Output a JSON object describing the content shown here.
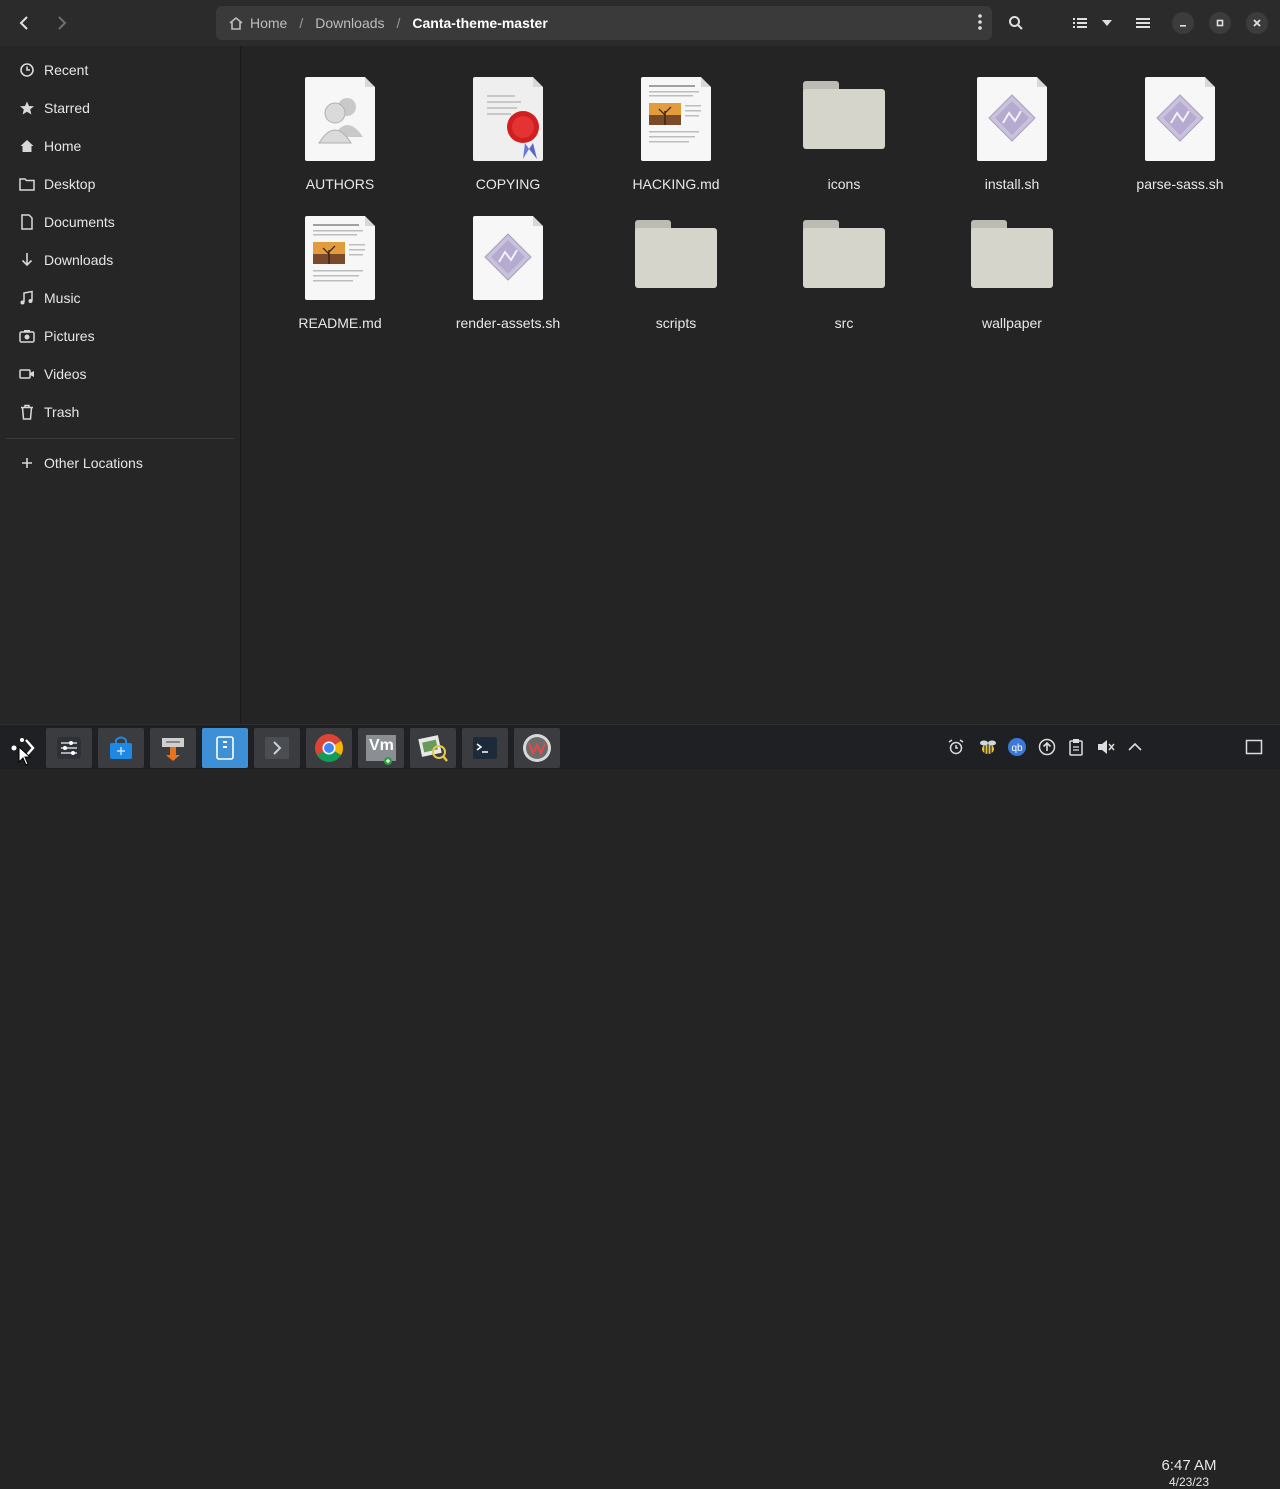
{
  "window": {
    "breadcrumb": [
      {
        "label": "Home",
        "icon": "home-icon"
      },
      {
        "label": "Downloads"
      },
      {
        "label": "Canta-theme-master"
      }
    ],
    "separator": "/"
  },
  "sidebar": {
    "items": [
      {
        "label": "Recent",
        "icon": "clock-icon"
      },
      {
        "label": "Starred",
        "icon": "star-icon"
      },
      {
        "label": "Home",
        "icon": "home-icon"
      },
      {
        "label": "Desktop",
        "icon": "folder-icon"
      },
      {
        "label": "Documents",
        "icon": "document-icon"
      },
      {
        "label": "Downloads",
        "icon": "download-icon"
      },
      {
        "label": "Music",
        "icon": "music-icon"
      },
      {
        "label": "Pictures",
        "icon": "camera-icon"
      },
      {
        "label": "Videos",
        "icon": "video-icon"
      },
      {
        "label": "Trash",
        "icon": "trash-icon"
      }
    ],
    "other_locations": "Other Locations"
  },
  "files": [
    {
      "name": "AUTHORS",
      "type": "authors"
    },
    {
      "name": "COPYING",
      "type": "license"
    },
    {
      "name": "HACKING.md",
      "type": "markdown"
    },
    {
      "name": "icons",
      "type": "folder"
    },
    {
      "name": "install.sh",
      "type": "script"
    },
    {
      "name": "parse-sass.sh",
      "type": "script"
    },
    {
      "name": "README.md",
      "type": "markdown"
    },
    {
      "name": "render-assets.sh",
      "type": "script"
    },
    {
      "name": "scripts",
      "type": "folder"
    },
    {
      "name": "src",
      "type": "folder"
    },
    {
      "name": "wallpaper",
      "type": "folder"
    }
  ],
  "taskbar": {
    "time": "6:47 AM",
    "date": "4/23/23",
    "vm_label": "Vm"
  },
  "colors": {
    "background": "#242424",
    "sidebar": "#262626",
    "pathbar": "#3a3a3a",
    "taskbar": "#1f2023",
    "folder": "#d6d5cc",
    "accent_blue": "#4a90d9"
  }
}
